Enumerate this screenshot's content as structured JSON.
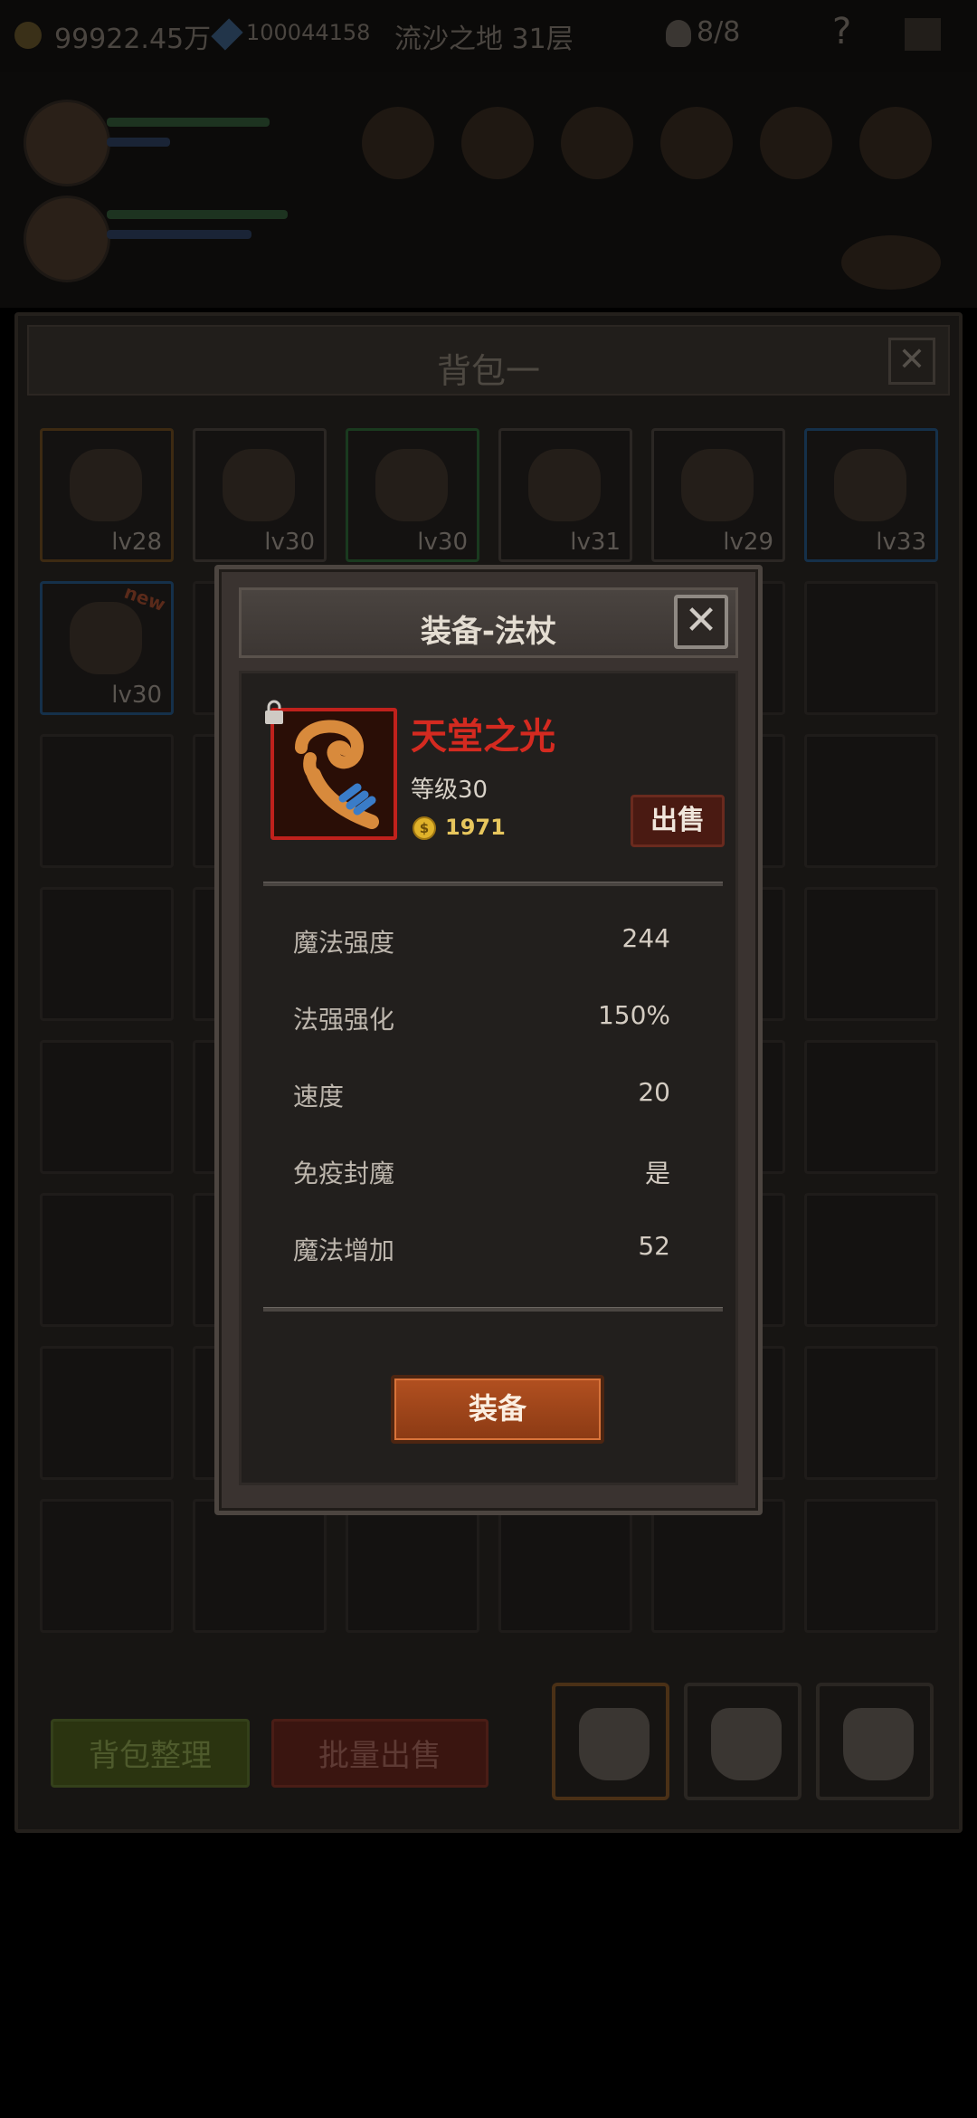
{
  "topbar": {
    "gold": "99922.45万",
    "gems": "100044158",
    "floor": "流沙之地 31层",
    "skull_count": "8/8",
    "help_label": "?"
  },
  "bag": {
    "title": "背包一",
    "close_label": "✕",
    "items": [
      {
        "level": "lv28",
        "quality": "orange"
      },
      {
        "level": "lv30",
        "quality": "plain"
      },
      {
        "level": "lv30",
        "quality": "green"
      },
      {
        "level": "lv31",
        "quality": "plain"
      },
      {
        "level": "lv29",
        "quality": "plain"
      },
      {
        "level": "lv33",
        "quality": "blue"
      },
      {
        "level": "lv30",
        "quality": "blue",
        "new_tag": "new"
      }
    ],
    "sort_label": "背包整理",
    "bulk_sell_label": "批量出售"
  },
  "modal": {
    "title": "装备-法杖",
    "close_label": "✕",
    "item_name": "天堂之光",
    "item_level": "等级30",
    "price_symbol": "$",
    "price": "1971",
    "sell_label": "出售",
    "stats": [
      {
        "label": "魔法强度",
        "value": "244"
      },
      {
        "label": "法强强化",
        "value": "150%"
      },
      {
        "label": "速度",
        "value": "20"
      },
      {
        "label": "免疫封魔",
        "value": "是"
      },
      {
        "label": "魔法增加",
        "value": "52"
      }
    ],
    "equip_label": "装备"
  },
  "colors": {
    "item_name": "#d42a20",
    "equip_button": "#b25020",
    "price": "#e7c65d"
  }
}
